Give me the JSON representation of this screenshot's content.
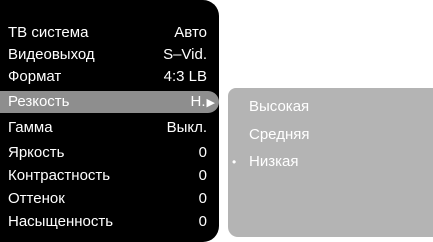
{
  "main_menu": {
    "rows": [
      {
        "label": "ТВ система",
        "value": "Авто"
      },
      {
        "label": "Видеовыход",
        "value": "S–Vid."
      },
      {
        "label": "Формат",
        "value": "4:3 LB"
      },
      {
        "label": "Резкость",
        "value": "Н."
      },
      {
        "label": "Гамма",
        "value": "Выкл."
      },
      {
        "label": "Яркость",
        "value": "0"
      },
      {
        "label": "Контрастность",
        "value": "0"
      },
      {
        "label": "Оттенок",
        "value": "0"
      },
      {
        "label": "Насыщенность",
        "value": "0"
      }
    ],
    "highlighted_row": "Резкость",
    "submenu_arrow": "▶"
  },
  "submenu": {
    "items": [
      {
        "label": "Высокая"
      },
      {
        "label": "Средняя"
      },
      {
        "label": "Низкая"
      }
    ],
    "selected_item": "Низкая",
    "selected_marker": "•"
  },
  "colors": {
    "menu_background": "#000000",
    "highlight": "#8e8e8e",
    "submenu_background": "#b4b4b4",
    "text": "#ffffff"
  }
}
